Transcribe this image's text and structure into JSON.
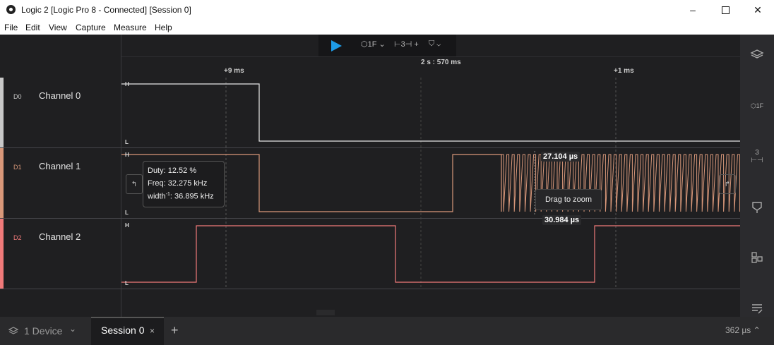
{
  "window": {
    "title": "Logic 2 [Logic Pro 8 - Connected] [Session 0]"
  },
  "menu": [
    "File",
    "Edit",
    "View",
    "Capture",
    "Measure",
    "Help"
  ],
  "toolbar": {
    "trigger_label": "1F",
    "measure_label": "3",
    "plus": "+"
  },
  "timeline": {
    "left_label": "+9 ms",
    "center_label": "2 s : 570 ms",
    "right_label": "+1 ms"
  },
  "channels": [
    {
      "id": "D0",
      "name": "Channel 0",
      "color": "#c8c8c8"
    },
    {
      "id": "D1",
      "name": "Channel 1",
      "color": "#d9987a"
    },
    {
      "id": "D2",
      "name": "Channel 2",
      "color": "#f07a7a"
    }
  ],
  "levels": {
    "high": "H",
    "low": "L"
  },
  "tooltip": {
    "duty": "Duty: 12.52 %",
    "freq": "Freq: 32.275 kHz",
    "width_pre": "width",
    "width_sup": "-1",
    "width_post": ": 36.895 kHz"
  },
  "measurements": {
    "top": "27.104 µs",
    "bottom": "30.984 µs",
    "drag": "Drag to zoom"
  },
  "sidebar": {
    "trigger_label": "1F",
    "measure_label": "3"
  },
  "bottom": {
    "device": "1 Device",
    "session": "Session 0",
    "close": "×",
    "add": "+",
    "time": "362 µs"
  }
}
